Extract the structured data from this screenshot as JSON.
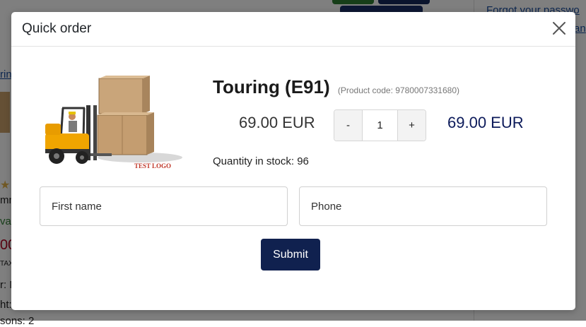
{
  "background": {
    "forgot_text": "Forgot your passwo",
    "forgot_text2": "an",
    "fragments": [
      "rin",
      "mm",
      "vai",
      "00",
      "TAX",
      "r: N",
      "ht:",
      "sons: 2"
    ]
  },
  "modal": {
    "title": "Quick order",
    "product": {
      "name": "Touring (E91)",
      "code": "(Product code: 9780007331680)",
      "unit_price": "69.00 EUR",
      "total_price": "69.00 EUR",
      "stock": "Quantity in stock: 96",
      "image_text": "TEST LOGO"
    },
    "quantity": {
      "value": "1",
      "minus": "-",
      "plus": "+"
    },
    "form": {
      "first_name_placeholder": "First name",
      "phone_placeholder": "Phone",
      "submit_label": "Submit"
    }
  },
  "colors": {
    "overlay": "rgba(0,0,0,0.5)",
    "submit_bg": "#10214f",
    "total_price": "#0c1a5a",
    "link": "#1b4ea0"
  },
  "icons": {
    "close": "close-icon"
  }
}
